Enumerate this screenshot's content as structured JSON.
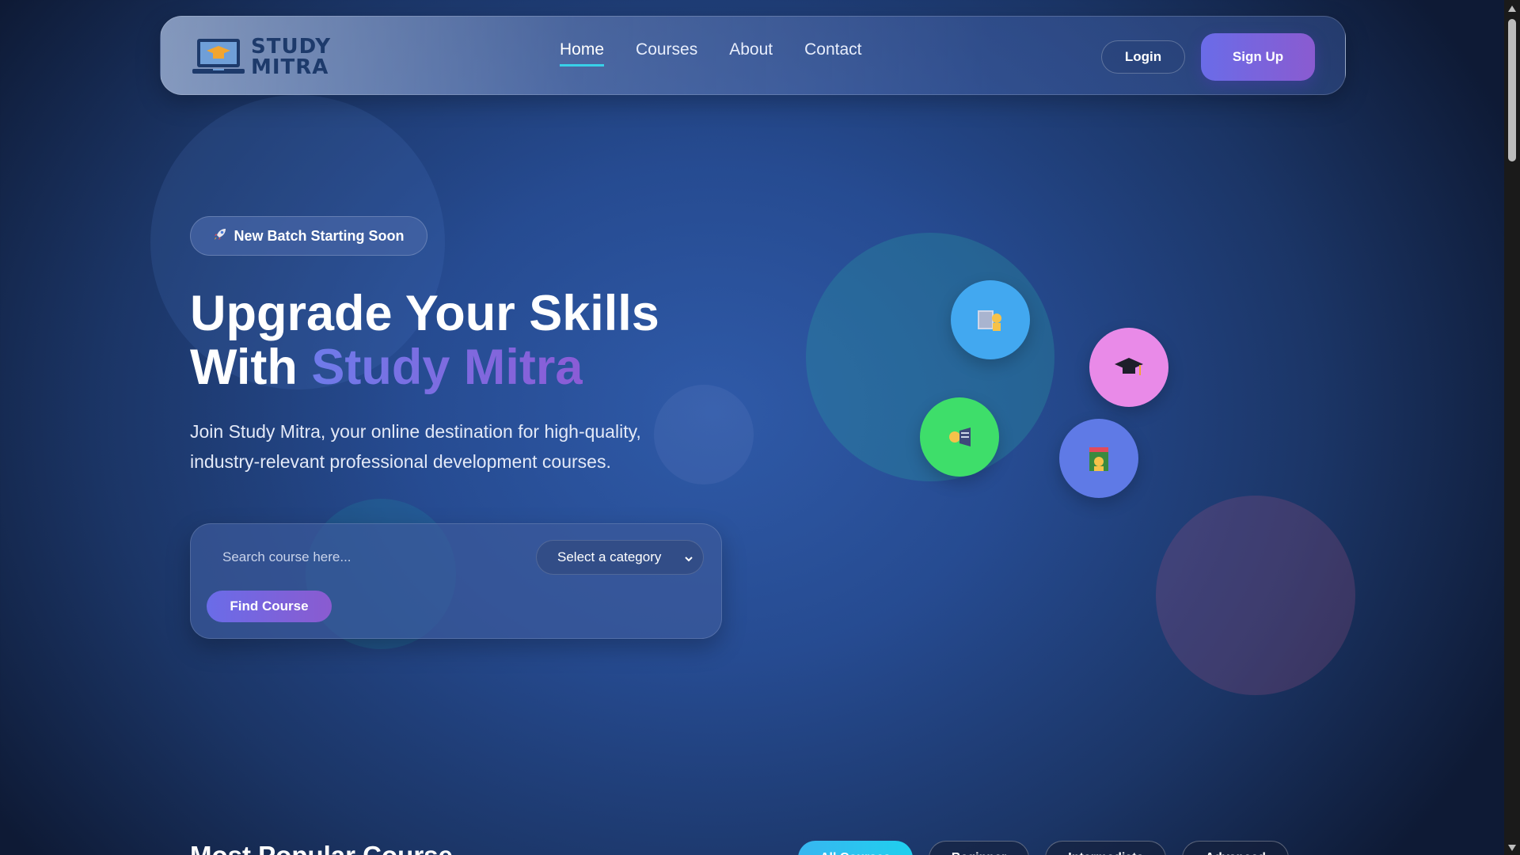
{
  "nav": {
    "logo_line1": "STUDY",
    "logo_line2": "MITRA",
    "links": [
      {
        "label": "Home",
        "active": true
      },
      {
        "label": "Courses",
        "active": false
      },
      {
        "label": "About",
        "active": false
      },
      {
        "label": "Contact",
        "active": false
      }
    ],
    "login_label": "Login",
    "signup_label": "Sign Up"
  },
  "hero": {
    "badge_icon": "rocket-icon",
    "badge_text": "New Batch Starting Soon",
    "title_line1": "Upgrade Your Skills",
    "title_line2_prefix": "With ",
    "title_brand": "Study Mitra",
    "description": "Join Study Mitra, your online destination for high-quality, industry-relevant professional development courses."
  },
  "search": {
    "placeholder": "Search course here...",
    "category_selected": "Select a category",
    "find_label": "Find Course"
  },
  "floating_icons": [
    {
      "name": "teacher-board-icon",
      "color": "#42a8f0"
    },
    {
      "name": "graduation-cap-icon",
      "color": "#e98ae8"
    },
    {
      "name": "student-icon",
      "color": "#3ede6a"
    },
    {
      "name": "books-student-icon",
      "color": "#5f7ae6"
    }
  ],
  "popular": {
    "title": "Most Popular Course",
    "filters": [
      "All Courses",
      "Beginner",
      "Intermediate",
      "Advanced"
    ]
  },
  "colors": {
    "accent_gradient_start": "#6a6ce8",
    "accent_gradient_end": "#8a5bd0",
    "active_underline": "#38d0e8",
    "logo_text": "#1d3a6b"
  }
}
